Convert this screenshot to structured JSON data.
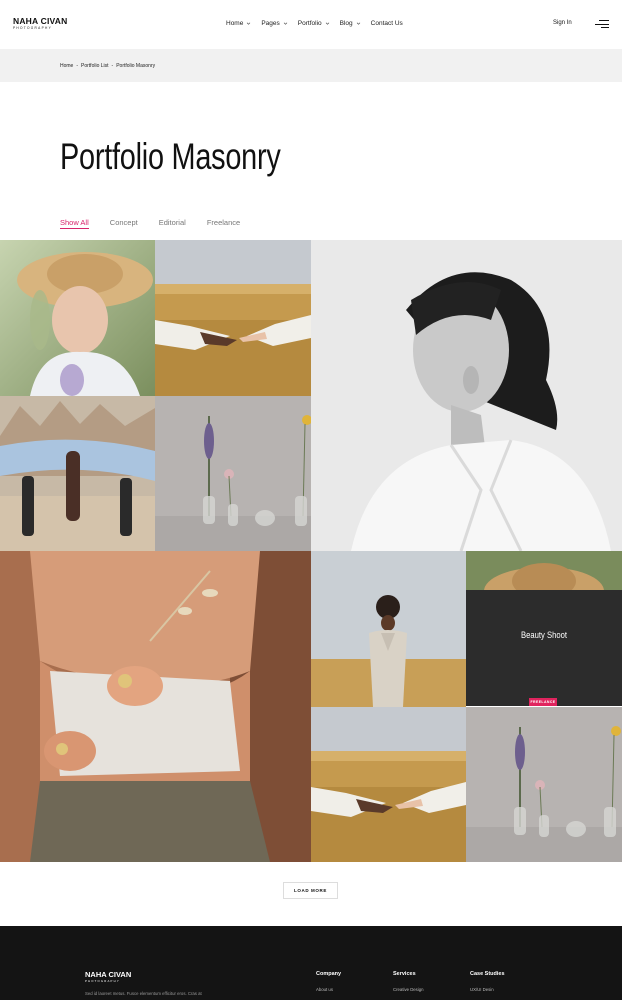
{
  "brand": {
    "name": "NAHA CIVAN",
    "tagline": "PHOTOGRAPHY"
  },
  "nav": [
    {
      "label": "Home",
      "has_dropdown": true
    },
    {
      "label": "Pages",
      "has_dropdown": true
    },
    {
      "label": "Portfolio",
      "has_dropdown": true
    },
    {
      "label": "Blog",
      "has_dropdown": true
    },
    {
      "label": "Contact Us",
      "has_dropdown": false
    }
  ],
  "header_actions": {
    "signin": "Sign In",
    "menu_icon": "hamburger-menu-icon"
  },
  "breadcrumb": [
    "Home",
    "Portfolio List",
    "Portfolio Masonry"
  ],
  "breadcrumb_separator": "-",
  "page_title": "Portfolio Masonry",
  "filters": [
    {
      "label": "Show All",
      "active": true
    },
    {
      "label": "Concept",
      "active": false
    },
    {
      "label": "Editorial",
      "active": false
    },
    {
      "label": "Freelance",
      "active": false
    }
  ],
  "portfolio": {
    "hover_card_title": "Beauty Shoot",
    "hover_card_tag": "FREELANCE",
    "accent_color": "#e0245e"
  },
  "load_more": "LOAD MORE",
  "footer": {
    "brand": "NAHA CIVAN",
    "tagline": "PHOTOGRAPHY",
    "text": "Sed id laoreet metus. Fusce elementum efficitur eros. Cras at",
    "columns": [
      {
        "title": "Company",
        "first_link": "About us"
      },
      {
        "title": "Services",
        "first_link": "Creative Design"
      },
      {
        "title": "Case Studies",
        "first_link": "UX/UI Desin"
      }
    ]
  }
}
